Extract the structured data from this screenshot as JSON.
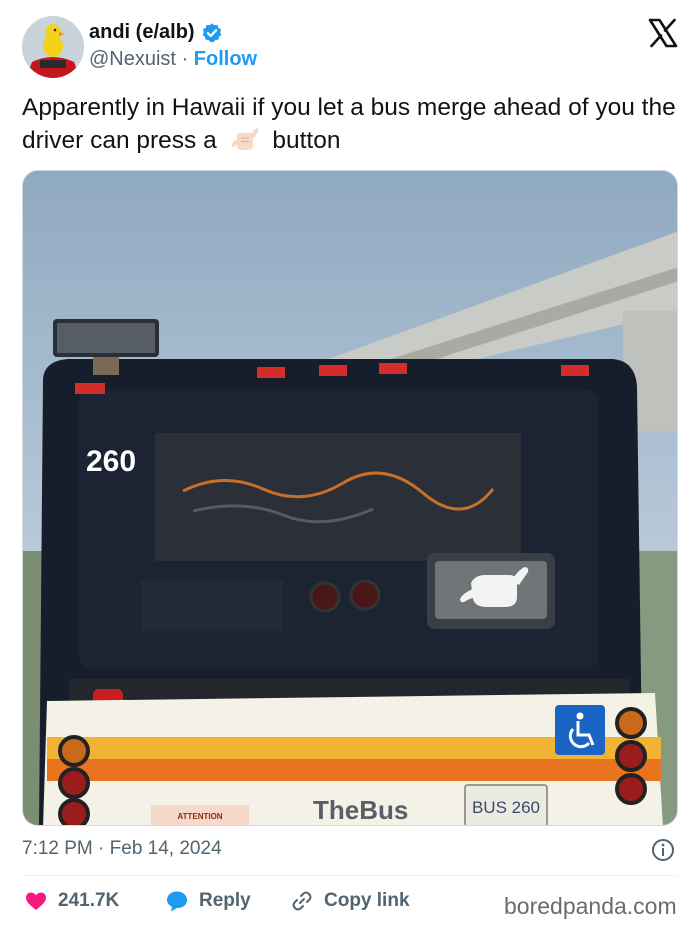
{
  "header": {
    "display_name": "andi (e/alb)",
    "handle": "@Nexuist",
    "separator": "·",
    "follow_label": "Follow"
  },
  "tweet": {
    "text_before_emoji": "Apparently in Hawaii if you let a bus merge ahead of you the driver can press a",
    "emoji": "shaka-emoji",
    "text_after_emoji": "button"
  },
  "media": {
    "bus_number": "260",
    "bus_logo": "TheBus",
    "plate": "BUS 260",
    "sticker": "ATTENTION"
  },
  "meta": {
    "time": "7:12 PM",
    "separator": "·",
    "date": "Feb 14, 2024"
  },
  "actions": {
    "like_count": "241.7K",
    "reply_label": "Reply",
    "copy_label": "Copy link"
  },
  "watermark": "boredpanda.com",
  "colors": {
    "accent": "#1d9bf0",
    "like": "#f91880",
    "text": "#0f1419",
    "muted": "#536471"
  }
}
